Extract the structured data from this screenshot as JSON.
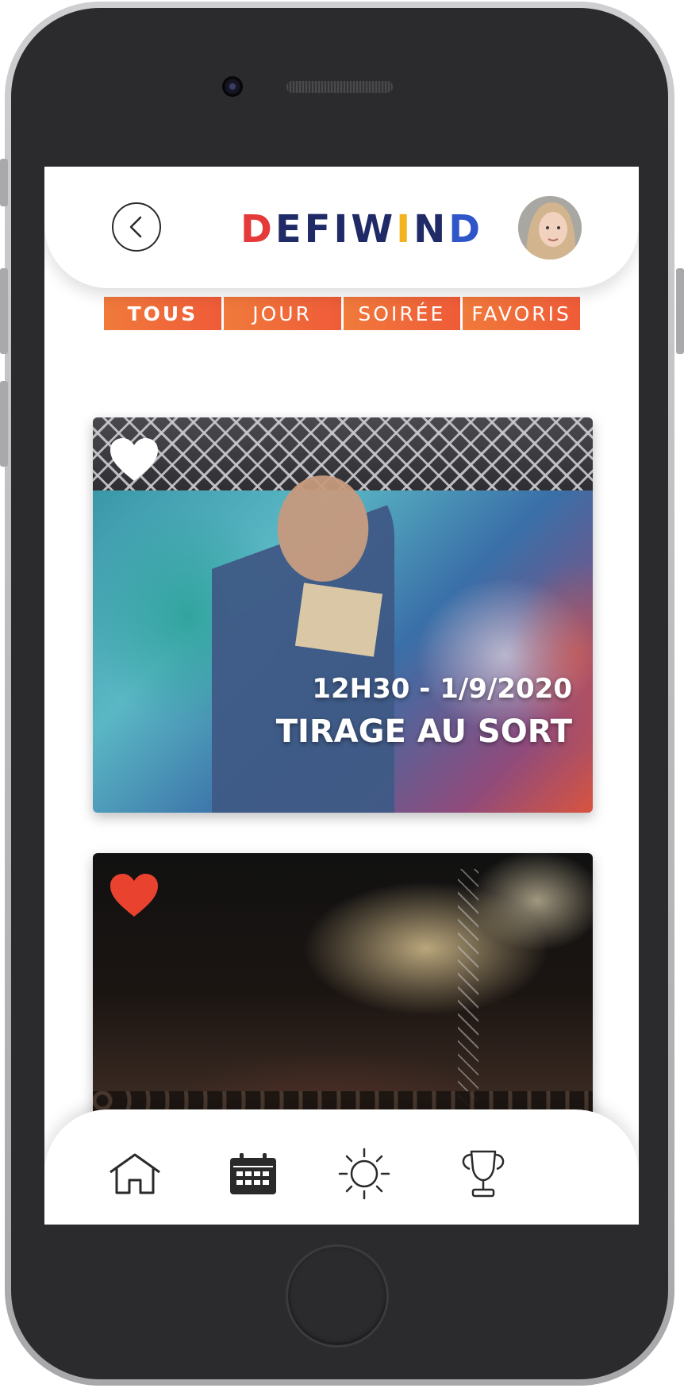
{
  "app": {
    "brand": {
      "letters": [
        "D",
        "E",
        "F",
        "I",
        "W",
        "I",
        "N",
        "D"
      ],
      "colors": [
        "#e53a3a",
        "#1f2a66",
        "#1f2a66",
        "#1f2a66",
        "#1f2a66",
        "#f2b320",
        "#1f2a66",
        "#2f56c8"
      ]
    },
    "avatar_alt": "avatar"
  },
  "tabs": [
    {
      "label": "TOUS",
      "active": true
    },
    {
      "label": "JOUR",
      "active": false
    },
    {
      "label": "SOIRÉE",
      "active": false
    },
    {
      "label": "FAVORIS",
      "active": false
    }
  ],
  "events": [
    {
      "time": "12H30 - 1/9/2020",
      "title": "TIRAGE AU SORT",
      "favorite": false
    },
    {
      "time": "",
      "title": "",
      "favorite": true
    }
  ],
  "nav": [
    {
      "icon": "home-icon"
    },
    {
      "icon": "calendar-icon"
    },
    {
      "icon": "sun-icon"
    },
    {
      "icon": "trophy-icon"
    }
  ],
  "colors": {
    "accent": "#ef5b38",
    "heart_active": "#e9432f",
    "heart_inactive": "#ffffff"
  }
}
